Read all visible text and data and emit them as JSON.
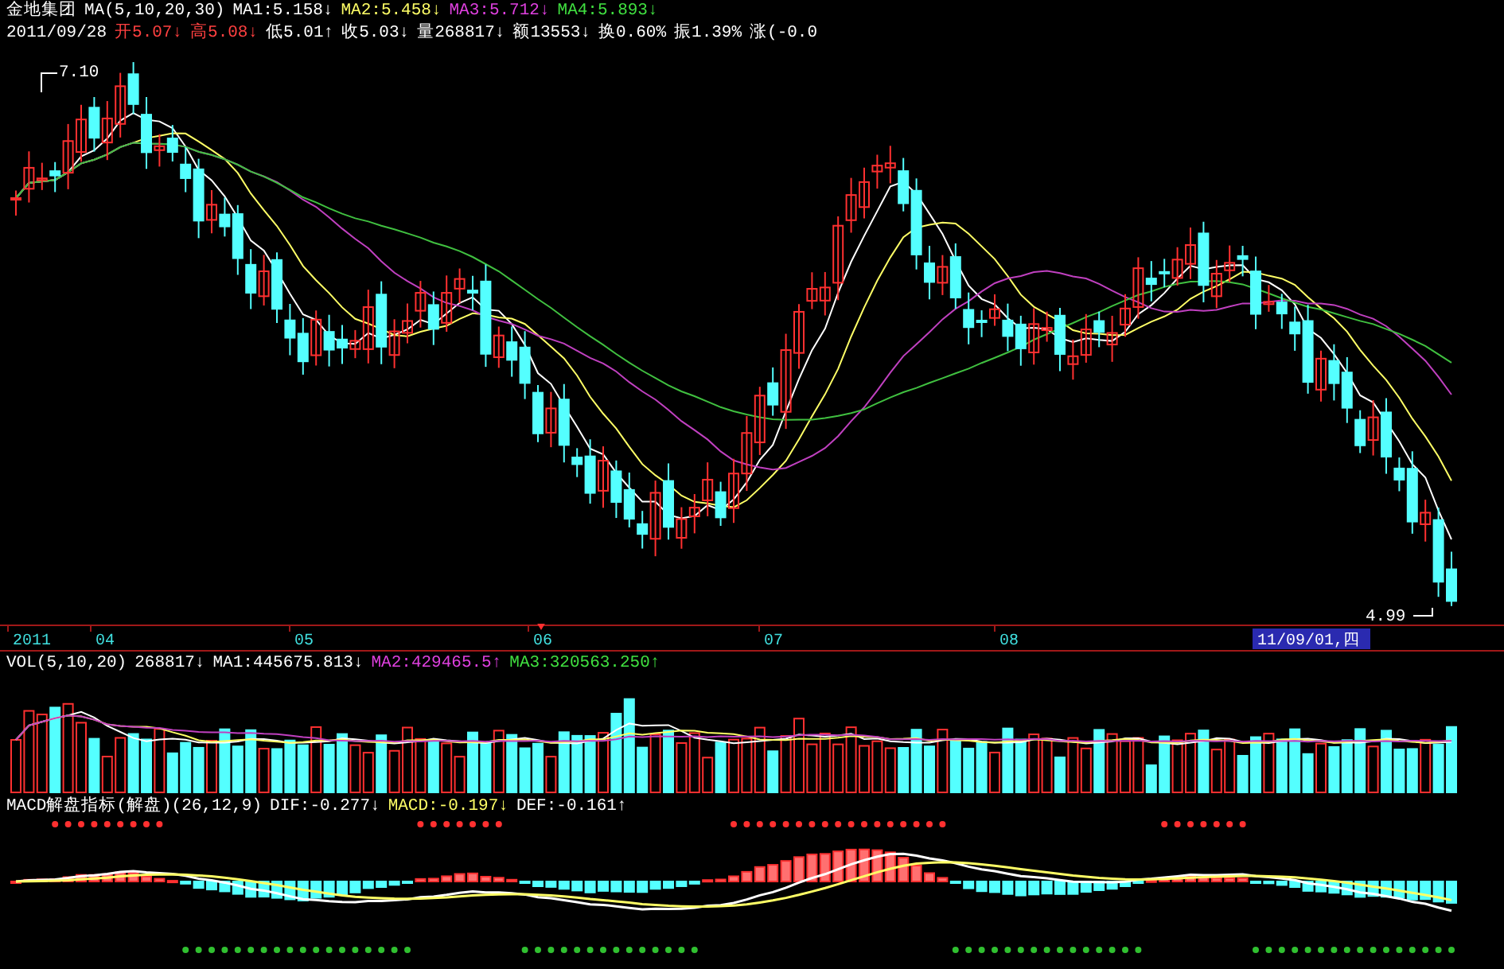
{
  "header": {
    "stock_name": "金地集团",
    "ma_params": "MA(5,10,20,30)",
    "indicators": [
      {
        "text": "MA1:5.158↓",
        "color": "#ffffff"
      },
      {
        "text": "MA2:5.458↓",
        "color": "#ffff66"
      },
      {
        "text": "MA3:5.712↓",
        "color": "#e040e0"
      },
      {
        "text": "MA4:5.893↓",
        "color": "#40e040"
      }
    ]
  },
  "quote_line": [
    {
      "text": "2011/09/28",
      "color": "#ffffff"
    },
    {
      "text": "开5.07↓",
      "color": "#ff4040"
    },
    {
      "text": "高5.08↓",
      "color": "#ff4040"
    },
    {
      "text": "低5.01↑",
      "color": "#ffffff"
    },
    {
      "text": "收5.03↓",
      "color": "#ffffff"
    },
    {
      "text": "量268817↓",
      "color": "#ffffff"
    },
    {
      "text": "额13553↓",
      "color": "#ffffff"
    },
    {
      "text": "换0.60%",
      "color": "#ffffff"
    },
    {
      "text": "振1.39%",
      "color": "#ffffff"
    },
    {
      "text": "涨(-0.0",
      "color": "#ffffff"
    }
  ],
  "price_chart": {
    "high_label": "7.10",
    "low_label": "4.99"
  },
  "time_axis": {
    "labels": [
      "2011",
      "04",
      "05",
      "06",
      "07",
      "08"
    ],
    "cursor_date": "11/09/01,四"
  },
  "volume_header": {
    "params": "VOL(5,10,20)",
    "items": [
      {
        "text": "268817↓",
        "color": "#ffffff"
      },
      {
        "text": "MA1:445675.813↓",
        "color": "#ffffff"
      },
      {
        "text": "MA2:429465.5↑",
        "color": "#e040e0"
      },
      {
        "text": "MA3:320563.250↑",
        "color": "#40e040"
      }
    ]
  },
  "macd_header": {
    "title": "MACD解盘指标(解盘)(26,12,9)",
    "items": [
      {
        "text": "DIF:-0.277↓",
        "color": "#ffffff"
      },
      {
        "text": "MACD:-0.197↓",
        "color": "#ffff66"
      },
      {
        "text": "DEF:-0.161↑",
        "color": "#ffffff"
      }
    ]
  }
}
